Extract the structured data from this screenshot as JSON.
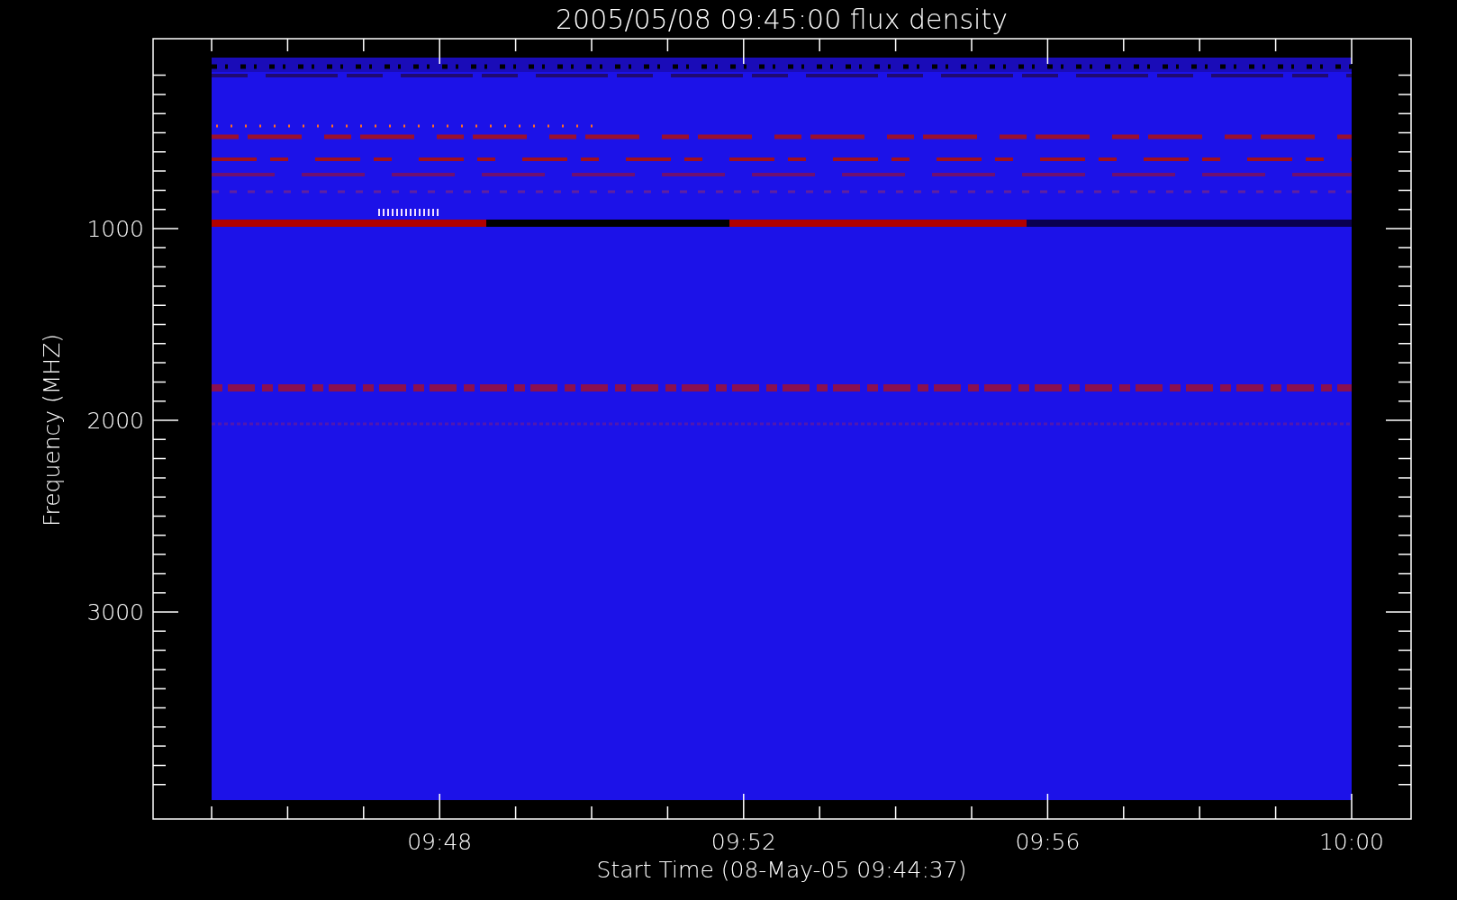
{
  "plot": {
    "title": "2005/05/08 09:45:00 flux density",
    "y_axis": {
      "label": "Frequency (MHZ)",
      "ticks": [
        "1000",
        "2000",
        "3000"
      ]
    },
    "x_axis": {
      "label": "Start Time (08-May-05 09:44:37)",
      "ticks": [
        "09:48",
        "09:52",
        "09:56",
        "10:00"
      ]
    }
  }
}
